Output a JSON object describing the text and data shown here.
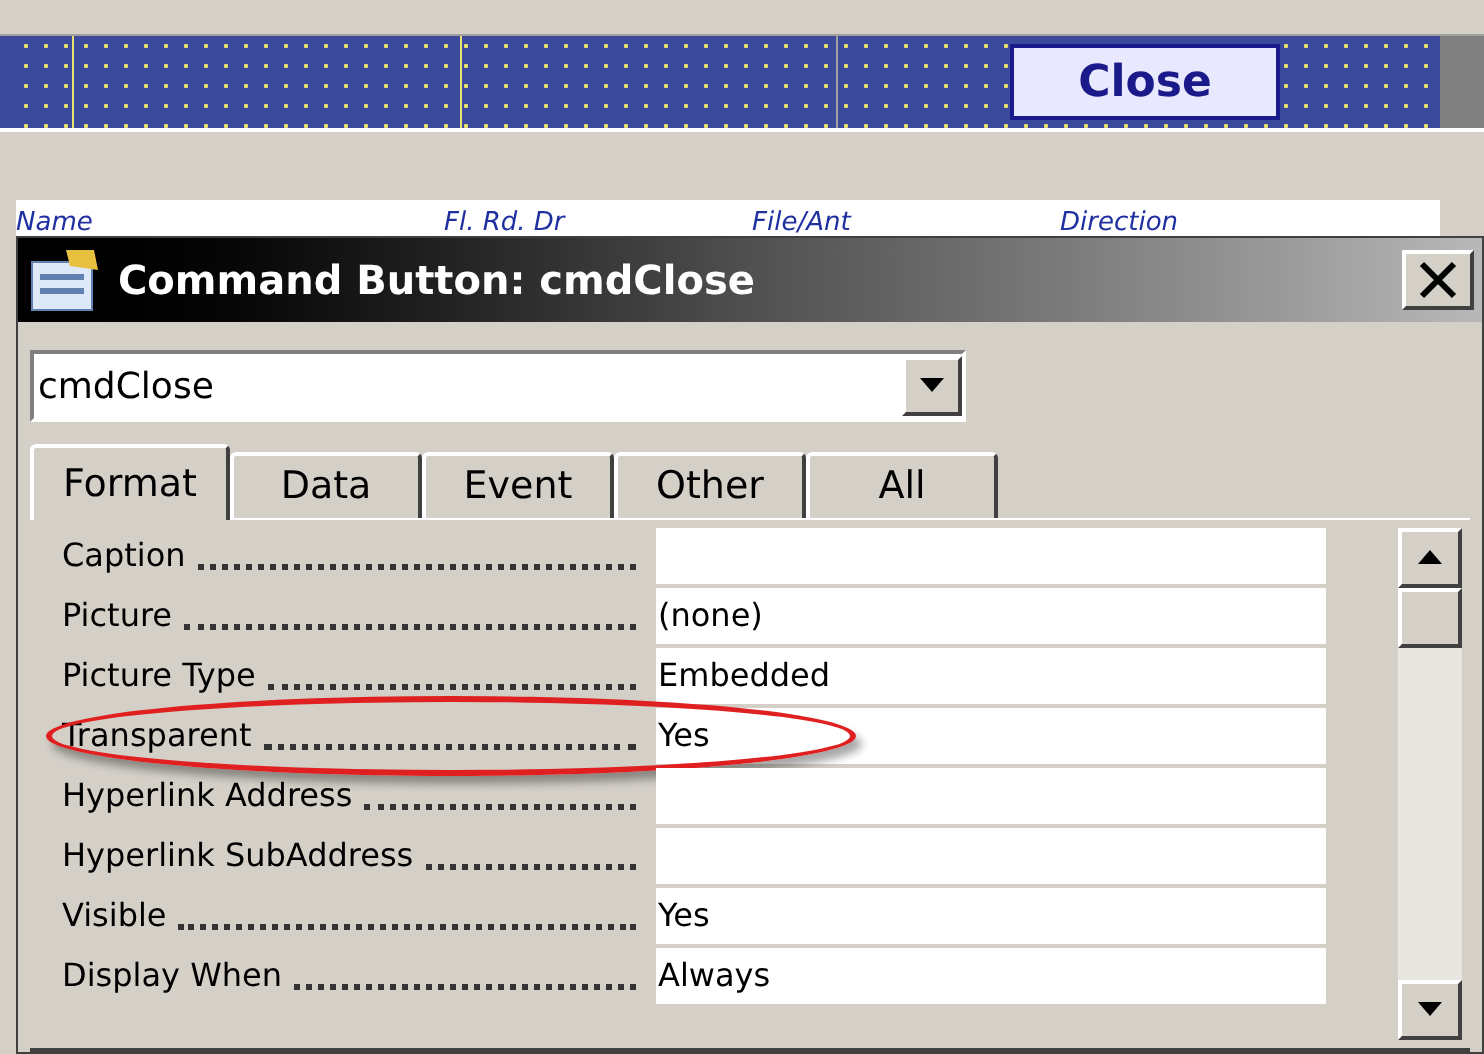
{
  "form_design": {
    "button_caption": "Close",
    "field_labels": [
      "Name",
      "Fl. Rd. Dr",
      "File/Ant",
      "Direction"
    ]
  },
  "window": {
    "title": "Command Button: cmdClose"
  },
  "object_selector": {
    "value": "cmdClose"
  },
  "tabs": [
    {
      "label": "Format",
      "selected": true
    },
    {
      "label": "Data",
      "selected": false
    },
    {
      "label": "Event",
      "selected": false
    },
    {
      "label": "Other",
      "selected": false
    },
    {
      "label": "All",
      "selected": false
    }
  ],
  "properties": [
    {
      "name": "Caption",
      "highlighted": false
    },
    {
      "name": "Picture",
      "value": "(none)",
      "highlighted": false
    },
    {
      "name": "Picture Type",
      "value": "Embedded",
      "highlighted": false
    },
    {
      "name": "Transparent",
      "value": "Yes",
      "highlighted": true
    },
    {
      "name": "Hyperlink Address",
      "highlighted": false
    },
    {
      "name": "Hyperlink SubAddress",
      "highlighted": false
    },
    {
      "name": "Visible",
      "value": "Yes",
      "highlighted": false
    },
    {
      "name": "Display When",
      "value": "Always",
      "highlighted": false
    }
  ]
}
